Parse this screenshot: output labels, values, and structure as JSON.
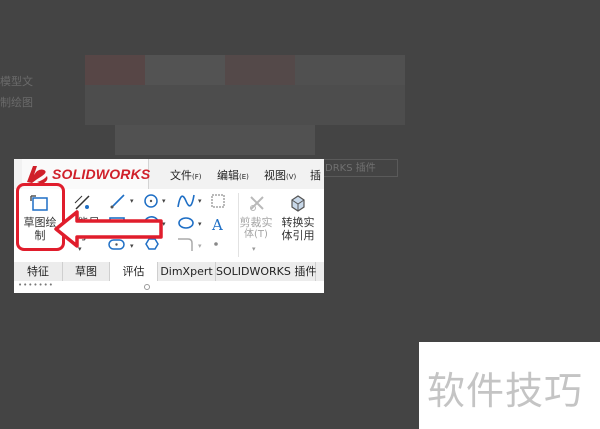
{
  "background": {
    "left_texts": [
      "模型文",
      "制绘图"
    ],
    "tab_strip_text": "DRKS 插件"
  },
  "app": {
    "logo_text": "SOLIDWORKS",
    "menu": [
      {
        "label": "文件",
        "key": "(F)"
      },
      {
        "label": "编辑",
        "key": "(E)"
      },
      {
        "label": "视图",
        "key": "(V)"
      },
      {
        "label": "插",
        "key": ""
      }
    ]
  },
  "ribbon": {
    "sketch_button": {
      "line1": "草图绘",
      "line2": "制"
    },
    "smart_dim_button": {
      "line1": "智能尺",
      "line2": "寸"
    },
    "trim_button": {
      "line1": "剪裁实",
      "line2": "体(T)"
    },
    "convert_button": {
      "line1": "转换实",
      "line2": "体引用"
    }
  },
  "tabs": [
    "特征",
    "草图",
    "评估",
    "DimXpert",
    "SOLIDWORKS 插件"
  ],
  "active_tab": "评估",
  "status": {
    "dots": "•••••••",
    "knob": "◎"
  },
  "watermark": "软件技巧",
  "colors": {
    "highlight": "#e01d2c",
    "logo_red": "#d0202a",
    "accent_blue": "#1f6fc5"
  }
}
